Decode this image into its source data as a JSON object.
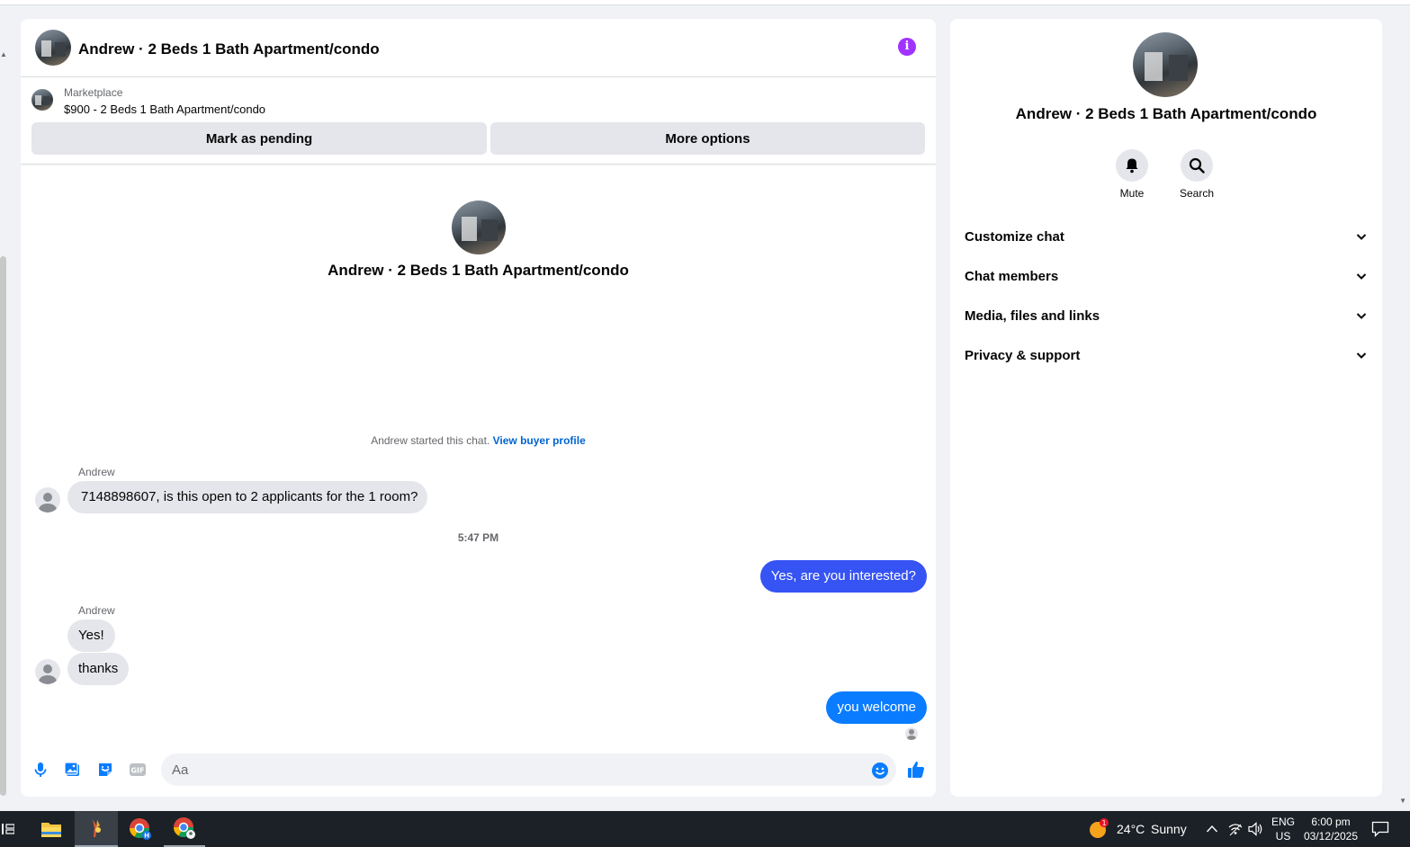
{
  "chat": {
    "title": "Andrew · 2 Beds 1 Bath Apartment/condo",
    "marketplace": {
      "label": "Marketplace",
      "listing": "$900 - 2 Beds 1 Bath Apartment/condo"
    },
    "buttons": {
      "pending": "Mark as pending",
      "more": "More options"
    },
    "intro_title": "Andrew · 2 Beds 1 Bath Apartment/condo",
    "started_text": "Andrew started this chat.",
    "view_profile": "View buyer profile",
    "messages": [
      {
        "sender": "Andrew",
        "text": "7148898607, is this open to 2 applicants for the 1 room?"
      },
      {
        "timestamp": "5:47 PM"
      },
      {
        "sender": "me",
        "text": "Yes, are you interested?"
      },
      {
        "sender": "Andrew",
        "text": "Yes!"
      },
      {
        "sender": "Andrew",
        "text": "thanks"
      },
      {
        "sender": "me",
        "text": "you welcome"
      }
    ],
    "composer_placeholder": "Aa"
  },
  "info_panel": {
    "title": "Andrew · 2 Beds 1 Bath Apartment/condo",
    "actions": [
      {
        "label": "Mute",
        "icon": "bell-icon"
      },
      {
        "label": "Search",
        "icon": "search-icon"
      }
    ],
    "sections": [
      "Customize chat",
      "Chat members",
      "Media, files and links",
      "Privacy & support"
    ]
  },
  "taskbar": {
    "weather_temp": "24°C",
    "weather_desc": "Sunny",
    "weather_badge": "1",
    "lang_top": "ENG",
    "lang_bottom": "US",
    "time": "6:00 pm",
    "date": "03/12/2025"
  },
  "colors": {
    "accent_blue": "#0a7cff",
    "info_purple": "#a033ff",
    "bubble_gray": "#e4e6eb"
  }
}
